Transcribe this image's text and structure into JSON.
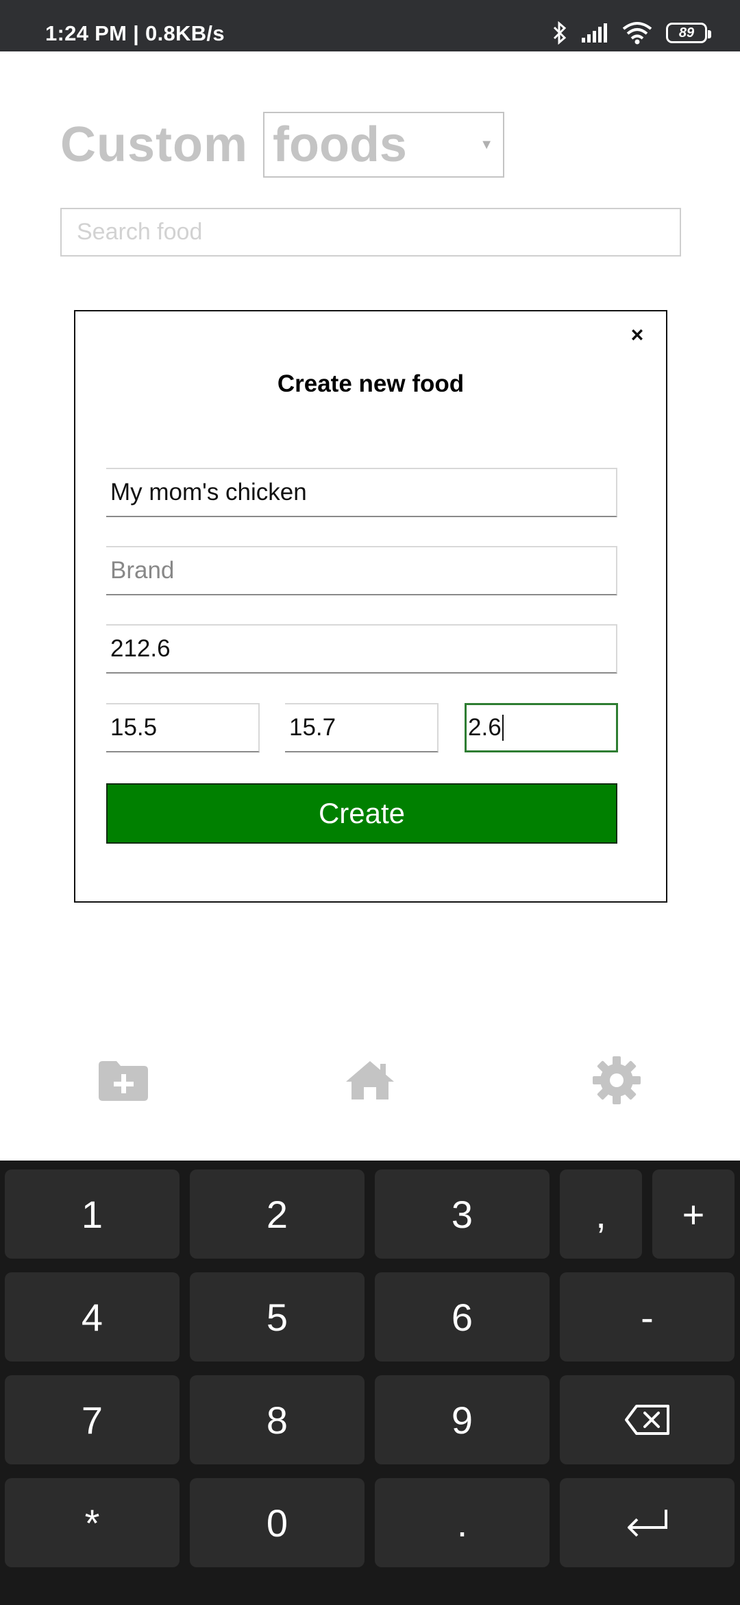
{
  "status": {
    "time": "1:24 PM | 0.8KB/s",
    "battery": "89",
    "icons": [
      "bluetooth-icon",
      "signal-icon",
      "wifi-icon",
      "battery-icon"
    ]
  },
  "header": {
    "title": "Custom",
    "category": "foods"
  },
  "search": {
    "placeholder": "Search food"
  },
  "modal": {
    "title": "Create new food",
    "close": "×",
    "name_value": "My mom's chicken",
    "brand_placeholder": "Brand",
    "calories_value": "212.6",
    "macro1_value": "15.5",
    "macro2_value": "15.7",
    "macro3_value": "2.6",
    "create_label": "Create"
  },
  "nav": {
    "items": [
      "add-folder-icon",
      "home-icon",
      "gear-icon"
    ]
  },
  "keyboard": {
    "rows": [
      [
        "1",
        "2",
        "3",
        ",",
        "+"
      ],
      [
        "4",
        "5",
        "6",
        "-"
      ],
      [
        "7",
        "8",
        "9",
        "backspace"
      ],
      [
        "*",
        "0",
        ".",
        "enter"
      ]
    ]
  },
  "colors": {
    "accent": "#008000",
    "status_bar": "#2f3033",
    "keyboard_bg": "#191919",
    "key_bg": "#2c2c2c",
    "muted_text": "#c4c4c4"
  }
}
